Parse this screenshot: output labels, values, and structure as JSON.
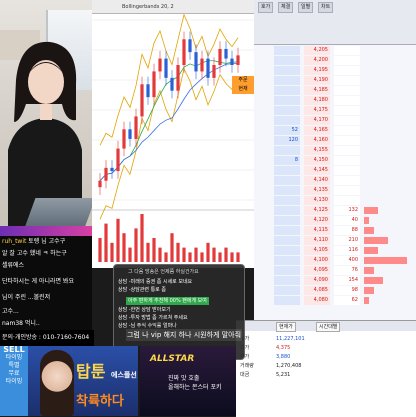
{
  "chart": {
    "title_bar": "Bollingerbands 20, 2",
    "price_label_top": "주문",
    "price_label_bottom": "현재"
  },
  "chat": {
    "lines": [
      {
        "user": "ruh_twit",
        "text": "토렝 님 고수구"
      },
      {
        "user": "",
        "text": "알 잘 고수 했네 ㅋ 하는구"
      },
      {
        "user": "",
        "text": "셀류에스"
      },
      {
        "user": "",
        "text": "단타하시는 게 아니라면 봐요"
      },
      {
        "user": "",
        "text": "님이 주린 ...볼린저"
      },
      {
        "user": "",
        "text": "고수..."
      },
      {
        "user": "",
        "text": "nam38 먹니.."
      }
    ],
    "phone": "문의·개인방송 : 010-7160-7604"
  },
  "popup": {
    "title": "그 다음 방송은 언제쯤 하실건가요",
    "lines": [
      "상담 -미래의 증권 좀 시세로 보네요",
      "상담 -상담관련 통로 좀",
      "상담 -한번 상담 받아보기",
      "상담 -투자 방법 좀 가르쳐 주세요",
      "상담 -님 주식 수익률 얼마나"
    ],
    "highlight": "아주 편하게 추천",
    "highlight_suffix": "해 00% 팬에게 보여",
    "message": "그럼 나 vip 해지 하나 시원하게 말아줘"
  },
  "orderbook": {
    "tabs": [
      "호가",
      "체결",
      "일별",
      "차트"
    ],
    "rows": [
      {
        "left": "",
        "price": "4,205",
        "right": "",
        "bar": 0
      },
      {
        "left": "",
        "price": "4,200",
        "right": "",
        "bar": 0
      },
      {
        "left": "",
        "price": "4,195",
        "right": "",
        "bar": 0
      },
      {
        "left": "",
        "price": "4,190",
        "right": "",
        "bar": 0
      },
      {
        "left": "",
        "price": "4,185",
        "right": "",
        "bar": 0
      },
      {
        "left": "",
        "price": "4,180",
        "right": "",
        "bar": 0
      },
      {
        "left": "",
        "price": "4,175",
        "right": "",
        "bar": 0
      },
      {
        "left": "",
        "price": "4,170",
        "right": "",
        "bar": 0
      },
      {
        "left": "52",
        "price": "4,165",
        "right": "",
        "bar": 0
      },
      {
        "left": "120",
        "price": "4,160",
        "right": "",
        "bar": 0
      },
      {
        "left": "",
        "price": "4,155",
        "right": "",
        "bar": 0
      },
      {
        "left": "8",
        "price": "4,150",
        "right": "",
        "bar": 0
      },
      {
        "left": "",
        "price": "4,145",
        "right": "",
        "bar": 0
      },
      {
        "left": "",
        "price": "4,140",
        "right": "",
        "bar": 0
      },
      {
        "left": "",
        "price": "4,135",
        "right": "",
        "bar": 0
      },
      {
        "left": "",
        "price": "4,130",
        "right": "",
        "bar": 0
      },
      {
        "left": "",
        "price": "4,125",
        "right": "132",
        "bar": 0.3
      },
      {
        "left": "",
        "price": "4,120",
        "right": "40",
        "bar": 0.1
      },
      {
        "left": "",
        "price": "4,115",
        "right": "88",
        "bar": 0.2
      },
      {
        "left": "",
        "price": "4,110",
        "right": "210",
        "bar": 0.5
      },
      {
        "left": "",
        "price": "4,105",
        "right": "116",
        "bar": 0.3
      },
      {
        "left": "",
        "price": "4,100",
        "right": "400",
        "bar": 0.9
      },
      {
        "left": "",
        "price": "4,095",
        "right": "76",
        "bar": 0.2
      },
      {
        "left": "",
        "price": "4,090",
        "right": "154",
        "bar": 0.4
      },
      {
        "left": "",
        "price": "4,085",
        "right": "98",
        "bar": 0.2
      },
      {
        "left": "",
        "price": "4,080",
        "right": "62",
        "bar": 0.1
      }
    ]
  },
  "info": {
    "tabs": [
      "현재가",
      "시간대별"
    ],
    "rows": [
      {
        "label": "시가",
        "value": "11,227,101",
        "cls": "info-val-blue"
      },
      {
        "label": "고가",
        "value": "4,375",
        "cls": "info-val-red"
      },
      {
        "label": "저가",
        "value": "3,880",
        "cls": "info-val-blue"
      },
      {
        "label": "거래량",
        "value": "1,270,408",
        "cls": ""
      },
      {
        "label": "대금",
        "value": "5,231",
        "cls": ""
      }
    ]
  },
  "banner": {
    "sell_line1": "SELL",
    "sell_line2": "타이밍",
    "sell_line3": "특별",
    "sell_line4": "무료",
    "sell_line5": "타이밍",
    "title_main": "탑툰",
    "title_sub": "에스플선",
    "title_second": "착륙하다",
    "allstar": "ALLSTAR",
    "right_line1": "진짜 맛 호출",
    "right_line2": "올해하는 몬스터 포키"
  },
  "chart_data": {
    "type": "line",
    "candles": [
      4010,
      4030,
      4025,
      4060,
      4090,
      4075,
      4110,
      4160,
      4140,
      4180,
      4200,
      4170,
      4150,
      4190,
      4230,
      4210,
      4180,
      4200,
      4170,
      4190,
      4215,
      4200,
      4190,
      4205
    ],
    "volume": [
      5,
      8,
      4,
      9,
      6,
      3,
      7,
      10,
      4,
      5,
      3,
      2,
      6,
      4,
      3,
      2,
      3,
      2,
      4,
      3,
      2,
      3,
      2,
      2
    ],
    "ylim": [
      3980,
      4260
    ]
  }
}
